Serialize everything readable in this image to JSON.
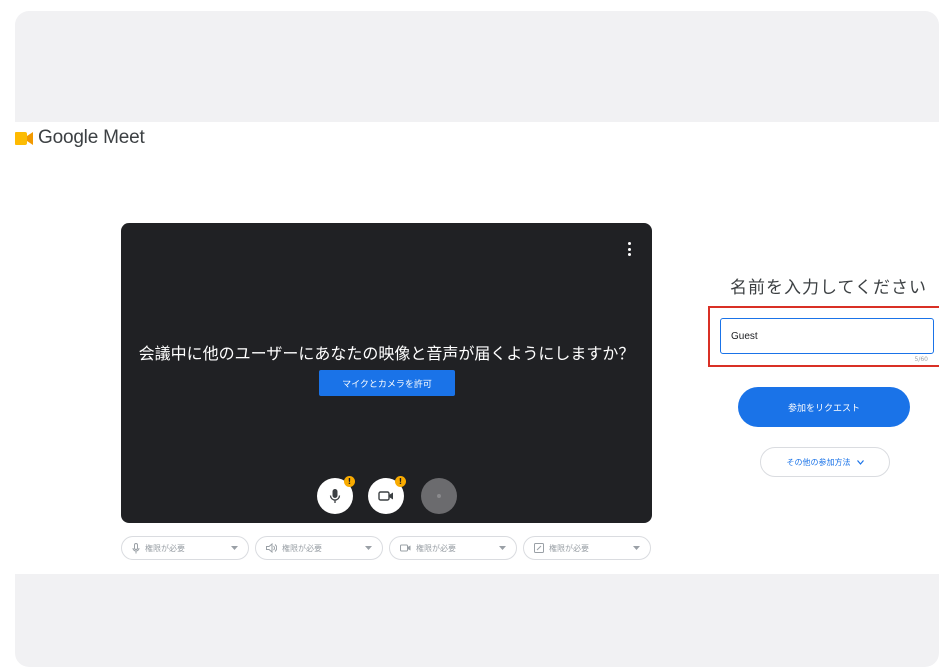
{
  "header": {
    "app_name": "Google Meet"
  },
  "preview": {
    "prompt": "会議中に他のユーザーにあなたの映像と音声が届くようにしますか？",
    "allow_button": "マイクとカメラを許可",
    "mic_badge": "!",
    "cam_badge": "!"
  },
  "device_selectors": [
    {
      "label": "権限が必要",
      "icon": "microphone-icon"
    },
    {
      "label": "権限が必要",
      "icon": "speaker-icon"
    },
    {
      "label": "権限が必要",
      "icon": "camera-icon"
    },
    {
      "label": "権限が必要",
      "icon": "effects-icon"
    }
  ],
  "join_panel": {
    "title": "名前を入力してください",
    "name_value": "Guest",
    "counter": "5/60",
    "join_button": "参加をリクエスト",
    "other_button": "その他の参加方法"
  },
  "colors": {
    "brand_blue": "#1a73e8",
    "preview_bg": "#202124",
    "highlight_red": "#d93025",
    "badge_yellow": "#f9ab00"
  }
}
